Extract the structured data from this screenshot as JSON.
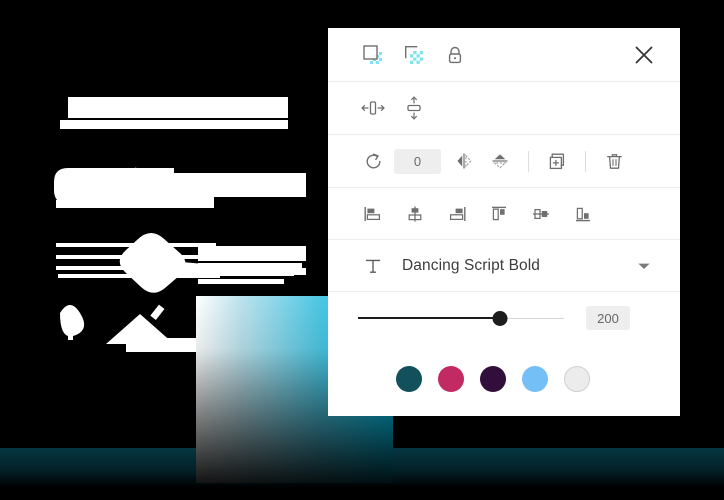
{
  "app": {
    "title": "Object properties panel",
    "canvas_background": "#000000",
    "panel_background": "#ffffff"
  },
  "canvas": {
    "artwork_description": "Abstract white silhouette shapes on black background",
    "glow_band_color": "#053641"
  },
  "gradient_picker": {
    "name": "color-field",
    "top_left_color": "#ffffff",
    "top_right_color": "#00c2ea",
    "bottom_color": "#000000"
  },
  "panel": {
    "close_label": "✕",
    "modes_row": {
      "items": [
        {
          "name": "fill-opaque-icon",
          "label": "Opaque fill"
        },
        {
          "name": "fill-transparent-icon",
          "label": "Transparent fill"
        },
        {
          "name": "lock-icon",
          "label": "Lock"
        }
      ]
    },
    "fit_row": {
      "items": [
        {
          "name": "fit-width-icon",
          "label": "Fit width"
        },
        {
          "name": "fit-height-icon",
          "label": "Fit height"
        }
      ]
    },
    "edit_row": {
      "rotate_label": "Rotate",
      "rotation_value": "0",
      "rotation_placeholder": "0",
      "flip_horizontal_label": "Flip horizontal",
      "flip_vertical_label": "Flip vertical",
      "duplicate_label": "Duplicate",
      "delete_label": "Delete"
    },
    "align_row": {
      "items": [
        {
          "name": "align-left-icon",
          "label": "Align left"
        },
        {
          "name": "align-center-horizontal-icon",
          "label": "Align center"
        },
        {
          "name": "align-right-icon",
          "label": "Align right"
        },
        {
          "name": "align-top-icon",
          "label": "Align top"
        },
        {
          "name": "align-middle-vertical-icon",
          "label": "Align middle"
        },
        {
          "name": "align-bottom-icon",
          "label": "Align bottom"
        }
      ]
    },
    "font_row": {
      "icon": "text-icon",
      "selected_font": "Dancing Script Bold",
      "chevron": "chevron-down-icon"
    },
    "size_row": {
      "value": "200",
      "min": "0",
      "max": "290",
      "percent": 69
    },
    "colors_row": {
      "swatches": [
        {
          "name": "swatch-teal",
          "hex": "#12505C"
        },
        {
          "name": "swatch-crimson",
          "hex": "#C22A63"
        },
        {
          "name": "swatch-plum",
          "hex": "#320E3B"
        },
        {
          "name": "swatch-skyblue",
          "hex": "#74BFF5"
        },
        {
          "name": "swatch-offwhite",
          "hex": "#ECECEC"
        }
      ]
    }
  }
}
